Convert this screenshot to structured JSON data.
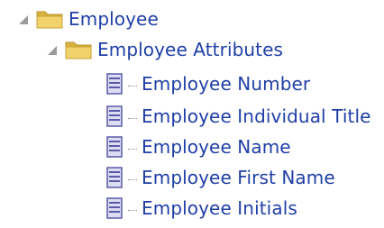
{
  "tree": {
    "root": {
      "label": "Employee",
      "icon": "folder-icon",
      "expanded": true,
      "children": [
        {
          "label": "Employee Attributes",
          "icon": "folder-icon",
          "expanded": true,
          "items": [
            {
              "label": "Employee Number",
              "icon": "attribute-icon"
            },
            {
              "label": "Employee Individual Title",
              "icon": "attribute-icon"
            },
            {
              "label": "Employee Name",
              "icon": "attribute-icon"
            },
            {
              "label": "Employee First Name",
              "icon": "attribute-icon"
            },
            {
              "label": "Employee Initials",
              "icon": "attribute-icon"
            }
          ]
        }
      ]
    }
  },
  "colors": {
    "text": "#1f3fa6",
    "toggle": "#9a9a9a",
    "folder_front": "#f2d36b",
    "folder_back": "#d9b33e",
    "attribute_icon": "#5a5aa8",
    "attribute_icon_fill": "#dcdcf2"
  }
}
